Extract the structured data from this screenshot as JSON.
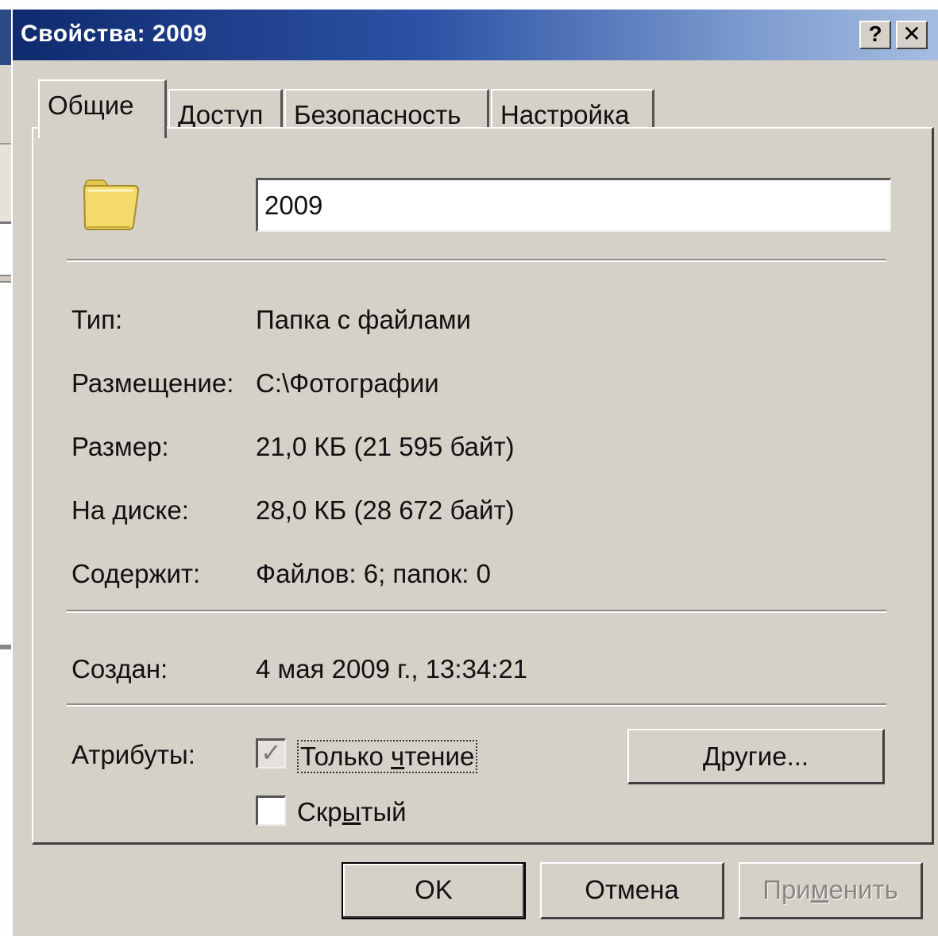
{
  "window": {
    "title": "Свойства: 2009",
    "help_button": "?",
    "close_button": "✕"
  },
  "tabs": [
    {
      "label": "Общие",
      "active": true
    },
    {
      "label": "Доступ",
      "active": false
    },
    {
      "label": "Безопасность",
      "active": false
    },
    {
      "label": "Настройка",
      "active": false
    }
  ],
  "general": {
    "folder_icon": "folder-icon",
    "name_value": "2009",
    "fields": {
      "type": {
        "label": "Тип:",
        "value": "Папка с файлами"
      },
      "location": {
        "label": "Размещение:",
        "value": "C:\\Фотографии"
      },
      "size": {
        "label": "Размер:",
        "value": "21,0 КБ (21 595 байт)"
      },
      "on_disk": {
        "label": "На диске:",
        "value": "28,0 КБ (28 672 байт)"
      },
      "contains": {
        "label": "Содержит:",
        "value": "Файлов: 6; папок: 0"
      },
      "created": {
        "label": "Создан:",
        "value": "4 мая 2009 г., 13:34:21"
      }
    },
    "attributes": {
      "label": "Атрибуты:",
      "readonly": {
        "label_pre": "Только ",
        "label_ul": "ч",
        "label_post": "тение",
        "checked": true
      },
      "hidden": {
        "label_pre": "Скр",
        "label_ul": "ы",
        "label_post": "тый",
        "checked": false
      },
      "other_button": {
        "label_ul": "Д",
        "label_post": "ругие..."
      }
    }
  },
  "buttons": {
    "ok": "OK",
    "cancel": "Отмена",
    "apply": {
      "label_pre": "При",
      "label_ul": "м",
      "label_post": "енить",
      "disabled": true
    }
  },
  "colors": {
    "title_bar_start": "#0f2a6e",
    "title_bar_end": "#a6bde0",
    "window_face": "#d5d0c8",
    "folder_yellow": "#f3da6a"
  }
}
